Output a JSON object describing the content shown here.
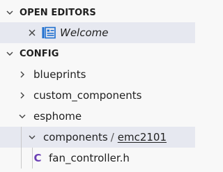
{
  "open_editors": {
    "header": "OPEN EDITORS",
    "items": [
      {
        "label": "Welcome",
        "icon": "welcome-tab-icon"
      }
    ]
  },
  "config": {
    "header": "CONFIG",
    "items": [
      {
        "label": "blueprints",
        "expanded": false
      },
      {
        "label": "custom_components",
        "expanded": false
      },
      {
        "label": "esphome",
        "expanded": true
      },
      {
        "label": "components",
        "sub": "emc2101",
        "separator": "/",
        "expanded": true
      },
      {
        "label": "fan_controller.h",
        "icon_glyph": "C"
      }
    ]
  },
  "colors": {
    "selection": "#e6e8f0",
    "c_icon": "#6b3fb4",
    "welcome_icon": "#1e6fcf"
  }
}
